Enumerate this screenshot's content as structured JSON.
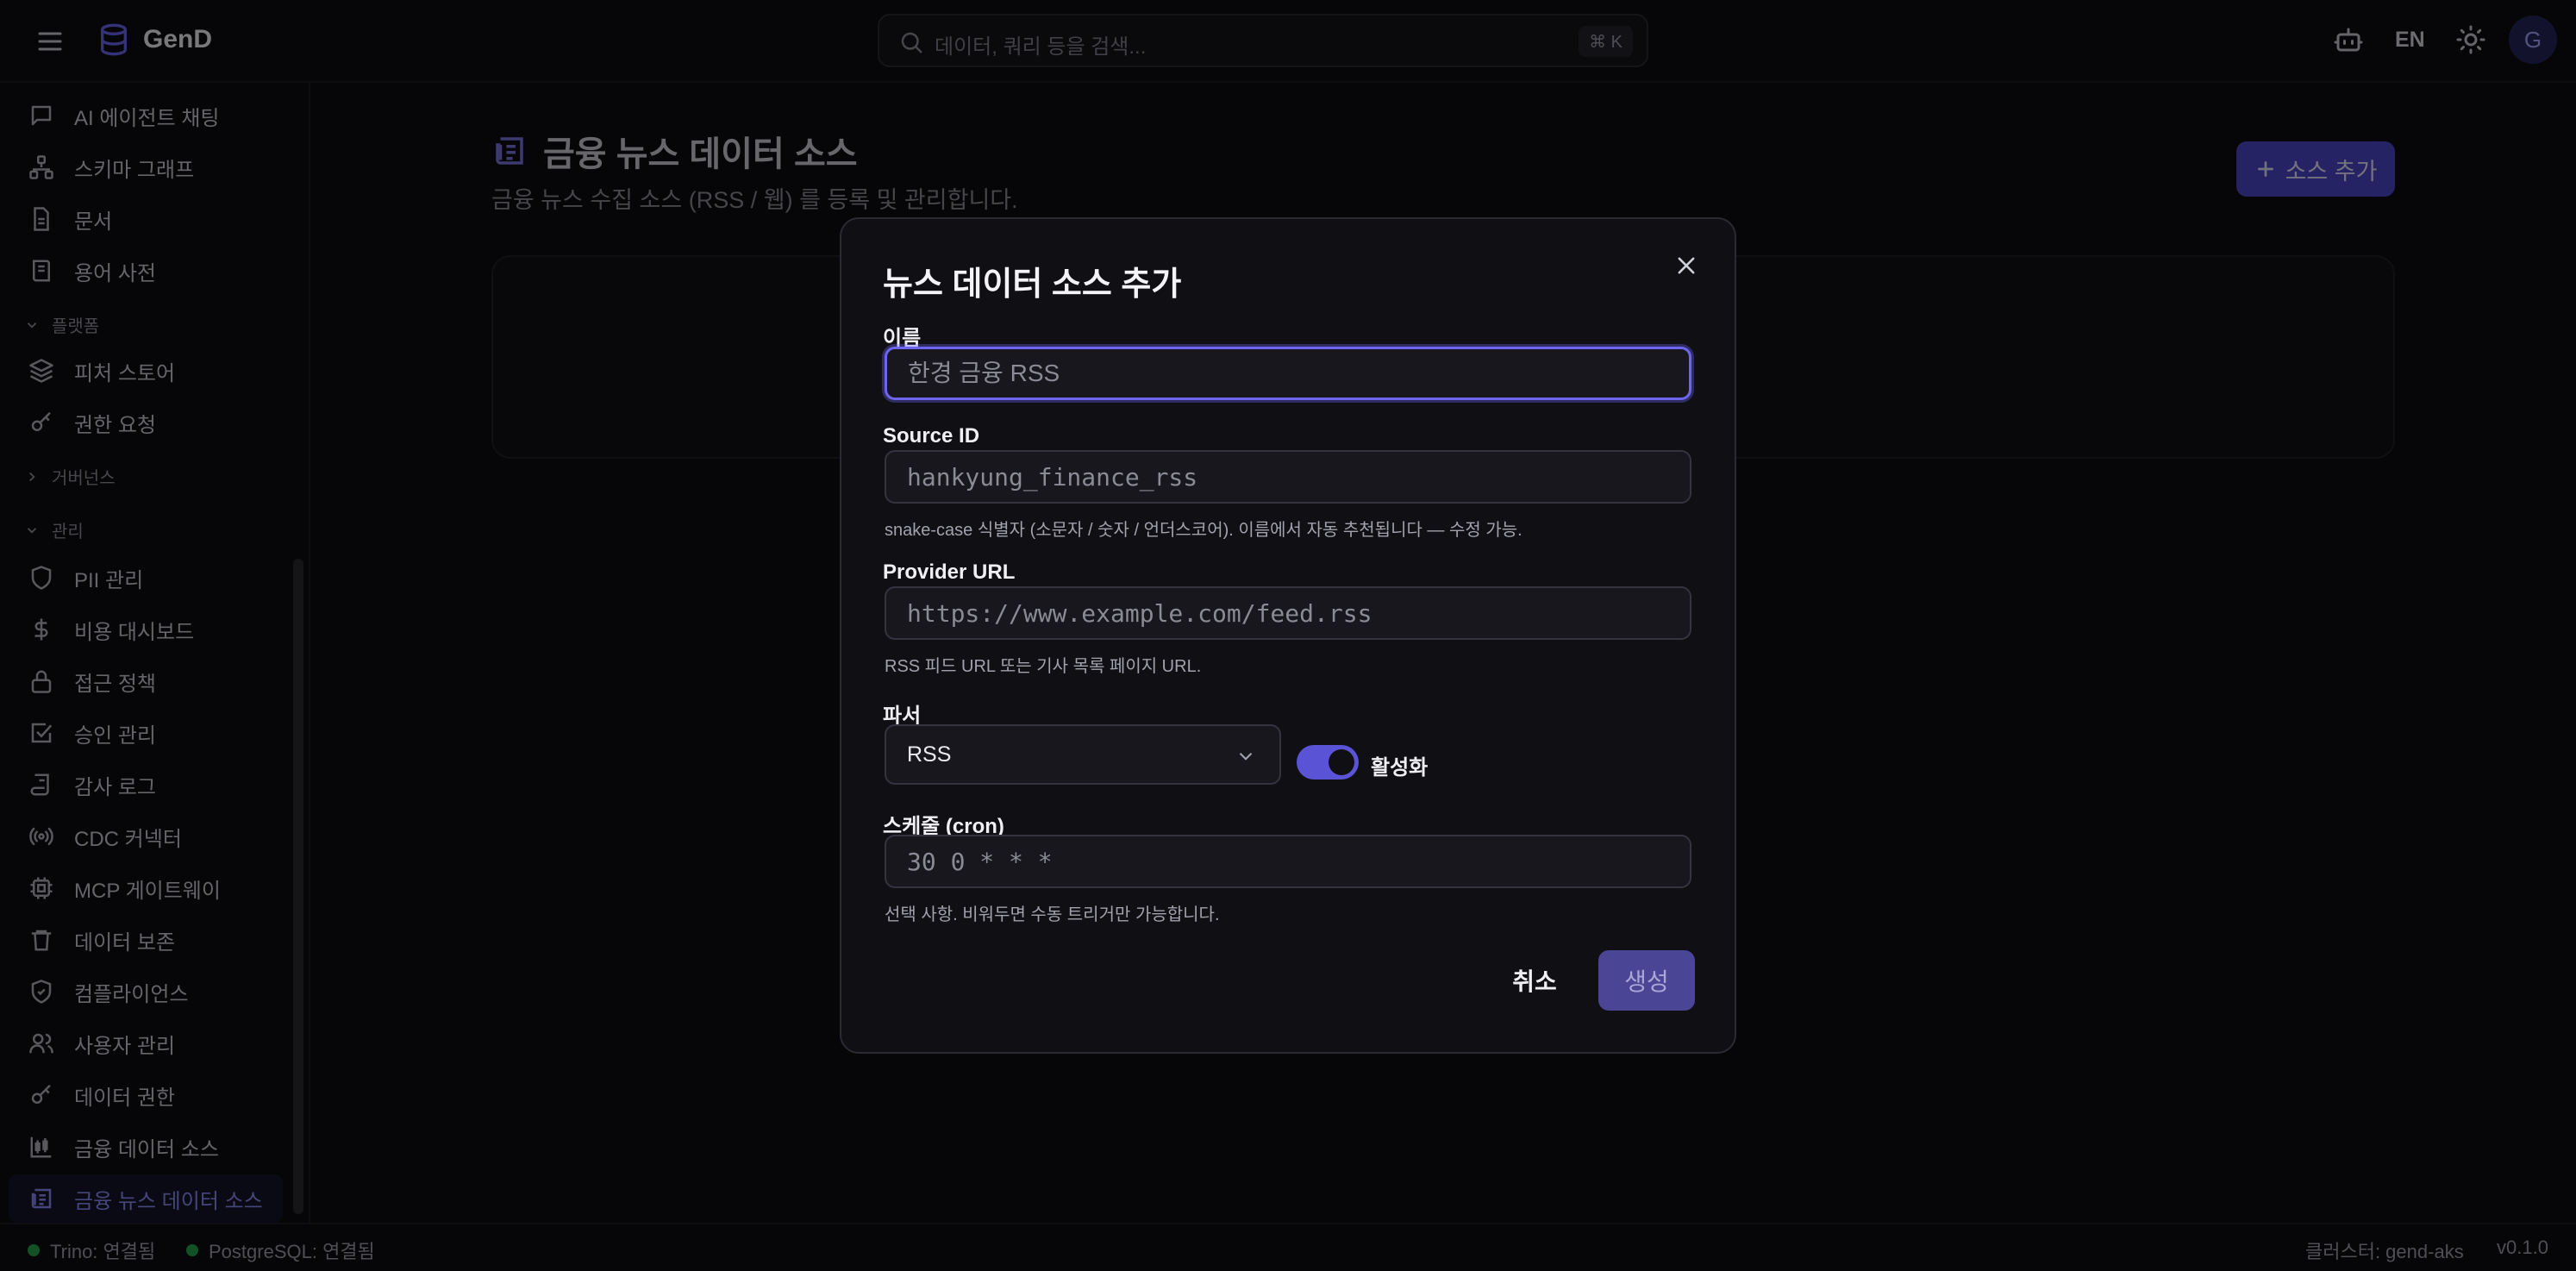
{
  "app": {
    "name": "GenD",
    "search_placeholder": "데이터, 쿼리 등을 검색...",
    "search_shortcut": "⌘ K",
    "language": "EN",
    "user_initial": "G"
  },
  "sidebar": {
    "items_top": [
      {
        "label": "AI 에이전트 채팅",
        "icon": "chat-icon"
      },
      {
        "label": "스키마 그래프",
        "icon": "schema-graph-icon"
      },
      {
        "label": "문서",
        "icon": "document-icon"
      },
      {
        "label": "용어 사전",
        "icon": "glossary-icon"
      }
    ],
    "group_platform": "플랫폼",
    "items_platform": [
      {
        "label": "피처 스토어",
        "icon": "layers-icon"
      },
      {
        "label": "권한 요청",
        "icon": "key-icon"
      }
    ],
    "group_governance": "거버넌스",
    "group_admin": "관리",
    "items_admin": [
      {
        "label": "PII 관리",
        "icon": "shield-icon"
      },
      {
        "label": "비용 대시보드",
        "icon": "dollar-icon"
      },
      {
        "label": "접근 정책",
        "icon": "lock-icon"
      },
      {
        "label": "승인 관리",
        "icon": "check-square-icon"
      },
      {
        "label": "감사 로그",
        "icon": "scroll-icon"
      },
      {
        "label": "CDC 커넥터",
        "icon": "radio-icon"
      },
      {
        "label": "MCP 게이트웨이",
        "icon": "cpu-icon"
      },
      {
        "label": "데이터 보존",
        "icon": "trash-icon"
      },
      {
        "label": "컴플라이언스",
        "icon": "shield-check-icon"
      },
      {
        "label": "사용자 관리",
        "icon": "users-icon"
      },
      {
        "label": "데이터 권한",
        "icon": "key-icon"
      },
      {
        "label": "금융 데이터 소스",
        "icon": "candlestick-icon"
      },
      {
        "label": "금융 뉴스 데이터 소스",
        "icon": "newspaper-icon"
      }
    ]
  },
  "page": {
    "title": "금융 뉴스 데이터 소스",
    "subtitle": "금융 뉴스 수집 소스 (RSS / 웹) 를 등록 및 관리합니다.",
    "add_button": "소스 추가"
  },
  "modal": {
    "title": "뉴스 데이터 소스 추가",
    "name_label": "이름",
    "name_placeholder": "한경 금융 RSS",
    "source_id_label": "Source ID",
    "source_id_placeholder": "hankyung_finance_rss",
    "source_id_hint": "snake-case 식별자 (소문자 / 숫자 / 언더스코어). 이름에서 자동 추천됩니다 — 수정 가능.",
    "provider_url_label": "Provider URL",
    "provider_url_placeholder": "https://www.example.com/feed.rss",
    "provider_url_hint": "RSS 피드 URL 또는 기사 목록 페이지 URL.",
    "parser_label": "파서",
    "parser_value": "RSS",
    "active_label": "활성화",
    "active_on": true,
    "schedule_label": "스케줄 (cron)",
    "schedule_placeholder": "30 0 * * *",
    "schedule_hint": "선택 사항. 비워두면 수동 트리거만 가능합니다.",
    "cancel": "취소",
    "create": "생성"
  },
  "statusbar": {
    "trino": "Trino: 연결됨",
    "postgres": "PostgreSQL: 연결됨",
    "cluster": "클러스터: gend-aks",
    "version": "v0.1.0"
  },
  "colors": {
    "accent": "#6d65f0",
    "active_text": "#8b8af5",
    "status_ok": "#22a34a"
  }
}
